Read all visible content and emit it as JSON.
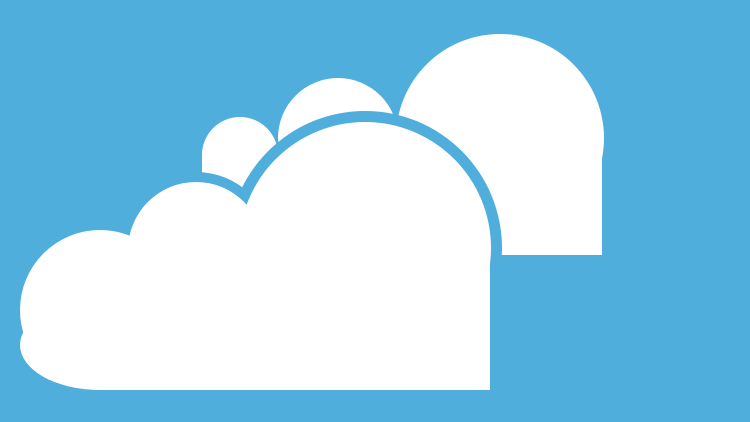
{
  "icon": {
    "name": "cloudy-weather-icon",
    "background_color": "#4FAEDC",
    "cloud_color": "#FFFFFF",
    "depicts": [
      "back-cloud-icon",
      "front-cloud-icon"
    ]
  }
}
